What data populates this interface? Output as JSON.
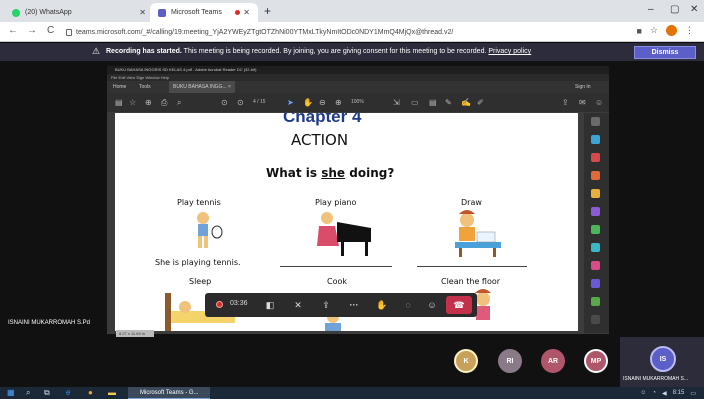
{
  "browser": {
    "tabs": [
      {
        "title": "(20) WhatsApp",
        "favicon_color": "#25d366"
      },
      {
        "title": "Microsoft Teams",
        "favicon_color": "#5b5fc7"
      }
    ],
    "new_tab": "+",
    "window_controls": {
      "minimize": "–",
      "maximize": "▢",
      "close": "✕"
    },
    "nav": {
      "back": "←",
      "forward": "→",
      "reload": "C"
    },
    "url": "teams.microsoft.com/_#/calling/19:meeting_YjA2YWEyZTgtOTZhNi00YTMxLTkyNmItODc0NDY1MmQ4MjQx@thread.v2/"
  },
  "banner": {
    "icon": "⚠",
    "bold": "Recording has started.",
    "text": " This meeting is being recorded. By joining, you are giving consent for this meeting to be recorded.",
    "link": "Privacy policy",
    "dismiss": "Dismiss"
  },
  "acrobat": {
    "title": "BUKU BAHASA INGGRIS SD KELAS 4.pdf - Adobe Acrobat Reader DC (32-bit)",
    "menu": "File  Edit  View  Sign  Window  Help",
    "tabs": {
      "home": "Home",
      "tools": "Tools",
      "doc": "BUKU BAHASA INGG... ×",
      "signin": "Sign In"
    },
    "page_indicator": "4 / 15",
    "zoom": "100%",
    "size_label": "8.27 x 11.69 in"
  },
  "document": {
    "chapter": "Chapter 4",
    "heading": "ACTION",
    "question_pre": "What is ",
    "question_subject": "she",
    "question_post": " doing?",
    "items": [
      {
        "label": "Play tennis",
        "answer": "She is playing tennis."
      },
      {
        "label": "Play piano",
        "answer": ""
      },
      {
        "label": "Draw",
        "answer": ""
      },
      {
        "label": "Sleep"
      },
      {
        "label": "Cook"
      },
      {
        "label": "Clean the floor"
      }
    ]
  },
  "presenter": "ISNAINI MUKARROMAH S.Pd",
  "call": {
    "timer": "03:36"
  },
  "participants": [
    {
      "initials": "K",
      "color": "#c8a15a"
    },
    {
      "initials": "RI",
      "color": "#8a7a88"
    },
    {
      "initials": "AR",
      "color": "#b0566a"
    },
    {
      "initials": "MP",
      "color": "#b0566a"
    }
  ],
  "self": {
    "initials": "IS",
    "name": "ISNAINI MUKARROMAH S..."
  },
  "taskbar": {
    "app": "Microsoft Teams - G...",
    "time": "8:15"
  }
}
